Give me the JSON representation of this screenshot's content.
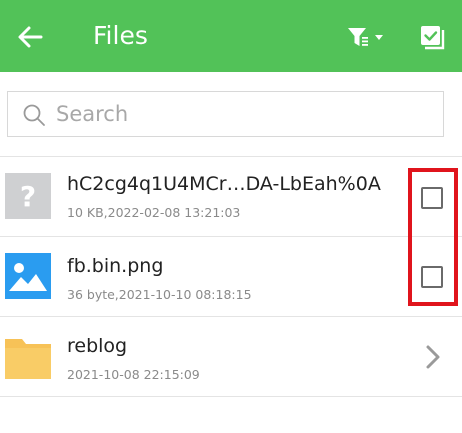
{
  "appbar": {
    "title": "Files",
    "bg_color": "#52c258",
    "back_icon": "arrow-left-icon",
    "filter_icon": "filter-dropdown-icon",
    "select_icon": "select-all-checkbox-icon"
  },
  "search": {
    "placeholder": "Search",
    "value": ""
  },
  "files": [
    {
      "name": "hC2cg4q1U4MCr…DA-LbEah%0A",
      "meta": "10 KB,2022-02-08 13:21:03",
      "icon": "unknown-file-icon",
      "action": "checkbox",
      "checked": false
    },
    {
      "name": "fb.bin.png",
      "meta": "36 byte,2021-10-10 08:18:15",
      "icon": "image-file-icon",
      "action": "checkbox",
      "checked": false
    },
    {
      "name": "reblog",
      "meta": "2021-10-08 22:15:09",
      "icon": "folder-icon",
      "action": "chevron",
      "checked": false
    }
  ],
  "highlight_color": "#e0141c"
}
